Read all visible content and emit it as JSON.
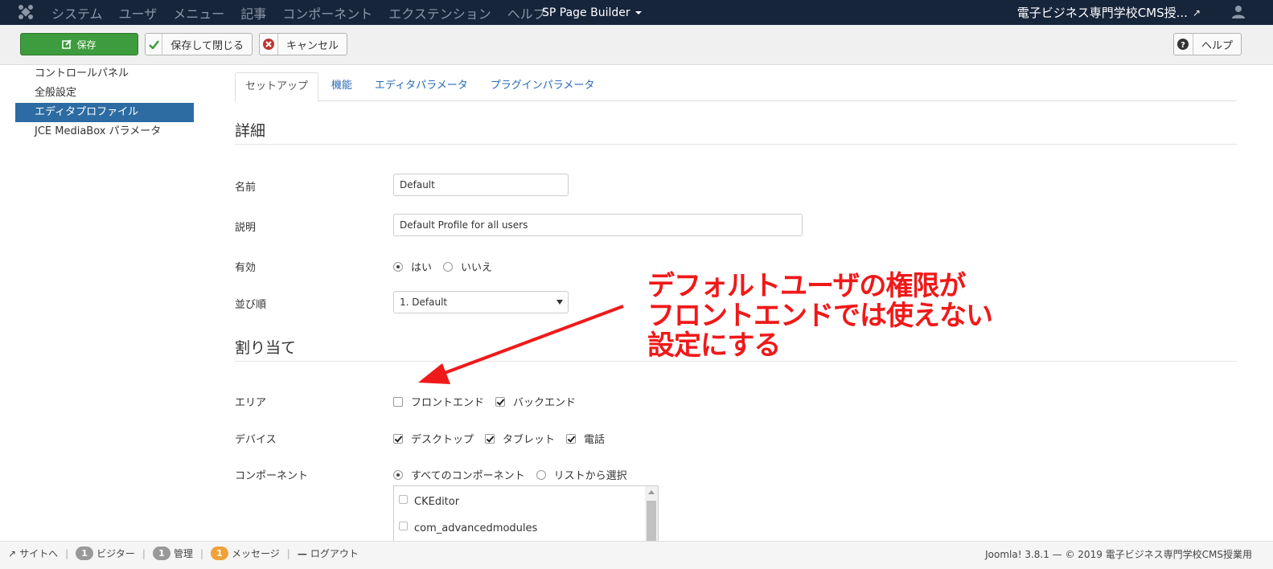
{
  "navbar": {
    "menu": [
      "システム",
      "ユーザ",
      "メニュー",
      "記事",
      "コンポーネント",
      "エクステンション",
      "ヘルプ"
    ],
    "sp_page_builder": "SP Page Builder",
    "site_name": "電子ビジネス専門学校CMS授..."
  },
  "toolbar": {
    "save": "保存",
    "save_close": "保存して閉じる",
    "cancel": "キャンセル",
    "help": "ヘルプ"
  },
  "sidebar": {
    "items": [
      {
        "label": "コントロールパネル",
        "active": false
      },
      {
        "label": "全般設定",
        "active": false
      },
      {
        "label": "エディタプロファイル",
        "active": true
      },
      {
        "label": "JCE MediaBox パラメータ",
        "active": false
      }
    ]
  },
  "tabs": [
    "セットアップ",
    "機能",
    "エディタパラメータ",
    "プラグインパラメータ"
  ],
  "details": {
    "legend": "詳細",
    "name_label": "名前",
    "name_value": "Default",
    "desc_label": "説明",
    "desc_value": "Default Profile for all users",
    "enabled_label": "有効",
    "yes": "はい",
    "no": "いいえ",
    "order_label": "並び順",
    "order_value": "1. Default"
  },
  "assignment": {
    "legend": "割り当て",
    "area_label": "エリア",
    "frontend": "フロントエンド",
    "backend": "バックエンド",
    "device_label": "デバイス",
    "desktop": "デスクトップ",
    "tablet": "タブレット",
    "phone": "電話",
    "component_label": "コンポーネント",
    "all_components": "すべてのコンポーネント",
    "select_from_list": "リストから選択",
    "components": [
      "CKEditor",
      "com_advancedmodules"
    ]
  },
  "annotation": {
    "line1": "デフォルトユーザの権限が",
    "line2": "フロントエンドでは使えない",
    "line3": "設定にする",
    "color": "#f01919"
  },
  "statusbar": {
    "site": "サイトへ",
    "visitors_count": "1",
    "visitors": "ビジター",
    "admin_count": "1",
    "admin": "管理",
    "messages_count": "1",
    "messages": "メッセージ",
    "logout": "ログアウト",
    "footer": "Joomla! 3.8.1 — © 2019 電子ビジネス専門学校CMS授業用"
  }
}
